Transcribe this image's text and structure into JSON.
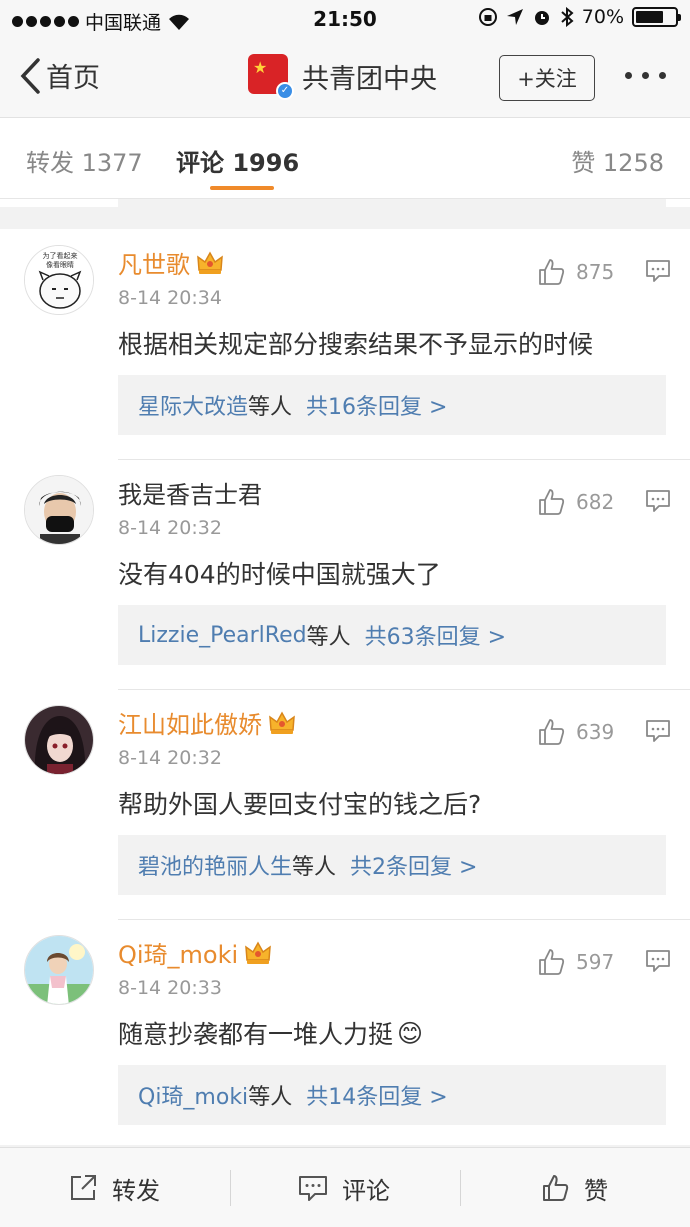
{
  "status_bar": {
    "carrier": "中国联通",
    "time": "21:50",
    "battery": "70%",
    "battery_level": 0.7
  },
  "nav": {
    "back_label": "首页",
    "title": "共青团中央",
    "follow_label": "+关注"
  },
  "tabs": [
    {
      "label": "转发 1377"
    },
    {
      "label": "评论 1996"
    },
    {
      "label": "赞 1258"
    }
  ],
  "comments": [
    {
      "name": "凡世歌",
      "vip": true,
      "time": "8-14 20:34",
      "text": "根据相关规定部分搜索结果不予显示的时候",
      "likes": "875",
      "reply_user": "星际大改造",
      "reply_mid": "等人",
      "reply_count": "共16条回复 >",
      "avatar_text": "你为了看起来 像看眼睛的吗"
    },
    {
      "name": "我是香吉士君",
      "vip": false,
      "time": "8-14 20:32",
      "text": "没有404的时候中国就强大了",
      "likes": "682",
      "reply_user": "Lizzie_PearlRed",
      "reply_mid": "等人",
      "reply_count": "共63条回复 >"
    },
    {
      "name": "江山如此傲娇",
      "vip": true,
      "time": "8-14 20:32",
      "text": "帮助外国人要回支付宝的钱之后?",
      "likes": "639",
      "reply_user": "碧池的艳丽人生",
      "reply_mid": "等人",
      "reply_count": "共2条回复 >"
    },
    {
      "name": "Qi琦_moki",
      "vip": true,
      "time": "8-14 20:33",
      "text": "随意抄袭都有一堆人力挺",
      "emoji": "😊",
      "likes": "597",
      "reply_user": "Qi琦_moki",
      "reply_mid": "等人",
      "reply_count": "共14条回复 >"
    }
  ],
  "toolbar": {
    "repost_label": "转发",
    "comment_label": "评论",
    "like_label": "赞"
  }
}
